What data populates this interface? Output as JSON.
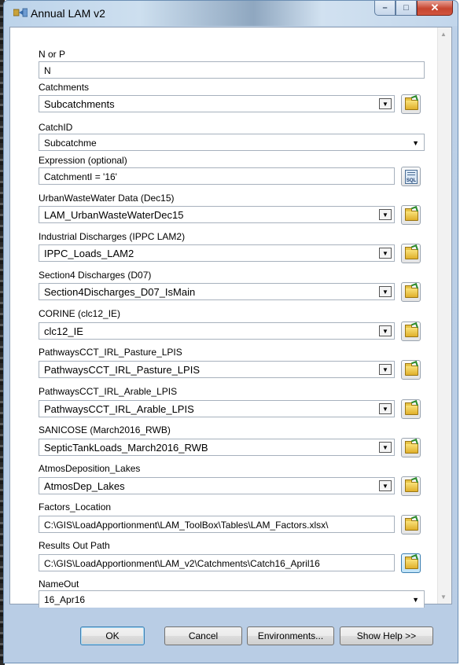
{
  "window": {
    "title": "Annual LAM v2",
    "icon": "tool-icon",
    "controls": [
      "minimize",
      "maximize",
      "close"
    ]
  },
  "params": [
    {
      "label": "N or P",
      "value": "N",
      "type": "text"
    },
    {
      "label": "Catchments",
      "value": "Subcatchments",
      "type": "combo",
      "browse": true
    },
    {
      "label": "CatchID",
      "value": "Subcatchme",
      "type": "dropdown"
    },
    {
      "label": "Expression (optional)",
      "value": "CatchmentI = '16'",
      "type": "sql"
    },
    {
      "label": "UrbanWasteWater Data (Dec15)",
      "value": "LAM_UrbanWasteWaterDec15",
      "type": "combo",
      "browse": true
    },
    {
      "label": "Industrial Discharges (IPPC LAM2)",
      "value": "IPPC_Loads_LAM2",
      "type": "combo",
      "browse": true
    },
    {
      "label": "Section4 Discharges (D07)",
      "value": "Section4Discharges_D07_IsMain",
      "type": "combo",
      "browse": true
    },
    {
      "label": "CORINE (clc12_IE)",
      "value": "clc12_IE",
      "type": "combo",
      "browse": true
    },
    {
      "label": "PathwaysCCT_IRL_Pasture_LPIS",
      "value": "PathwaysCCT_IRL_Pasture_LPIS",
      "type": "combo",
      "browse": true
    },
    {
      "label": "PathwaysCCT_IRL_Arable_LPIS",
      "value": "PathwaysCCT_IRL_Arable_LPIS",
      "type": "combo",
      "browse": true
    },
    {
      "label": "SANICOSE (March2016_RWB)",
      "value": "SepticTankLoads_March2016_RWB",
      "type": "combo",
      "browse": true
    },
    {
      "label": "AtmosDeposition_Lakes",
      "value": "AtmosDep_Lakes",
      "type": "combo",
      "browse": true
    },
    {
      "label": "Factors_Location",
      "value": "C:\\GIS\\LoadApportionment\\LAM_ToolBox\\Tables\\LAM_Factors.xlsx\\",
      "type": "path",
      "browse": true
    },
    {
      "label": "Results Out Path",
      "value": "C:\\GIS\\LoadApportionment\\LAM_v2\\Catchments\\Catch16_April16",
      "type": "path",
      "browse": true
    },
    {
      "label": "NameOut",
      "value": "16_Apr16",
      "type": "dropdown"
    }
  ],
  "buttons": {
    "ok": "OK",
    "cancel": "Cancel",
    "environments": "Environments...",
    "help": "Show Help >>"
  }
}
